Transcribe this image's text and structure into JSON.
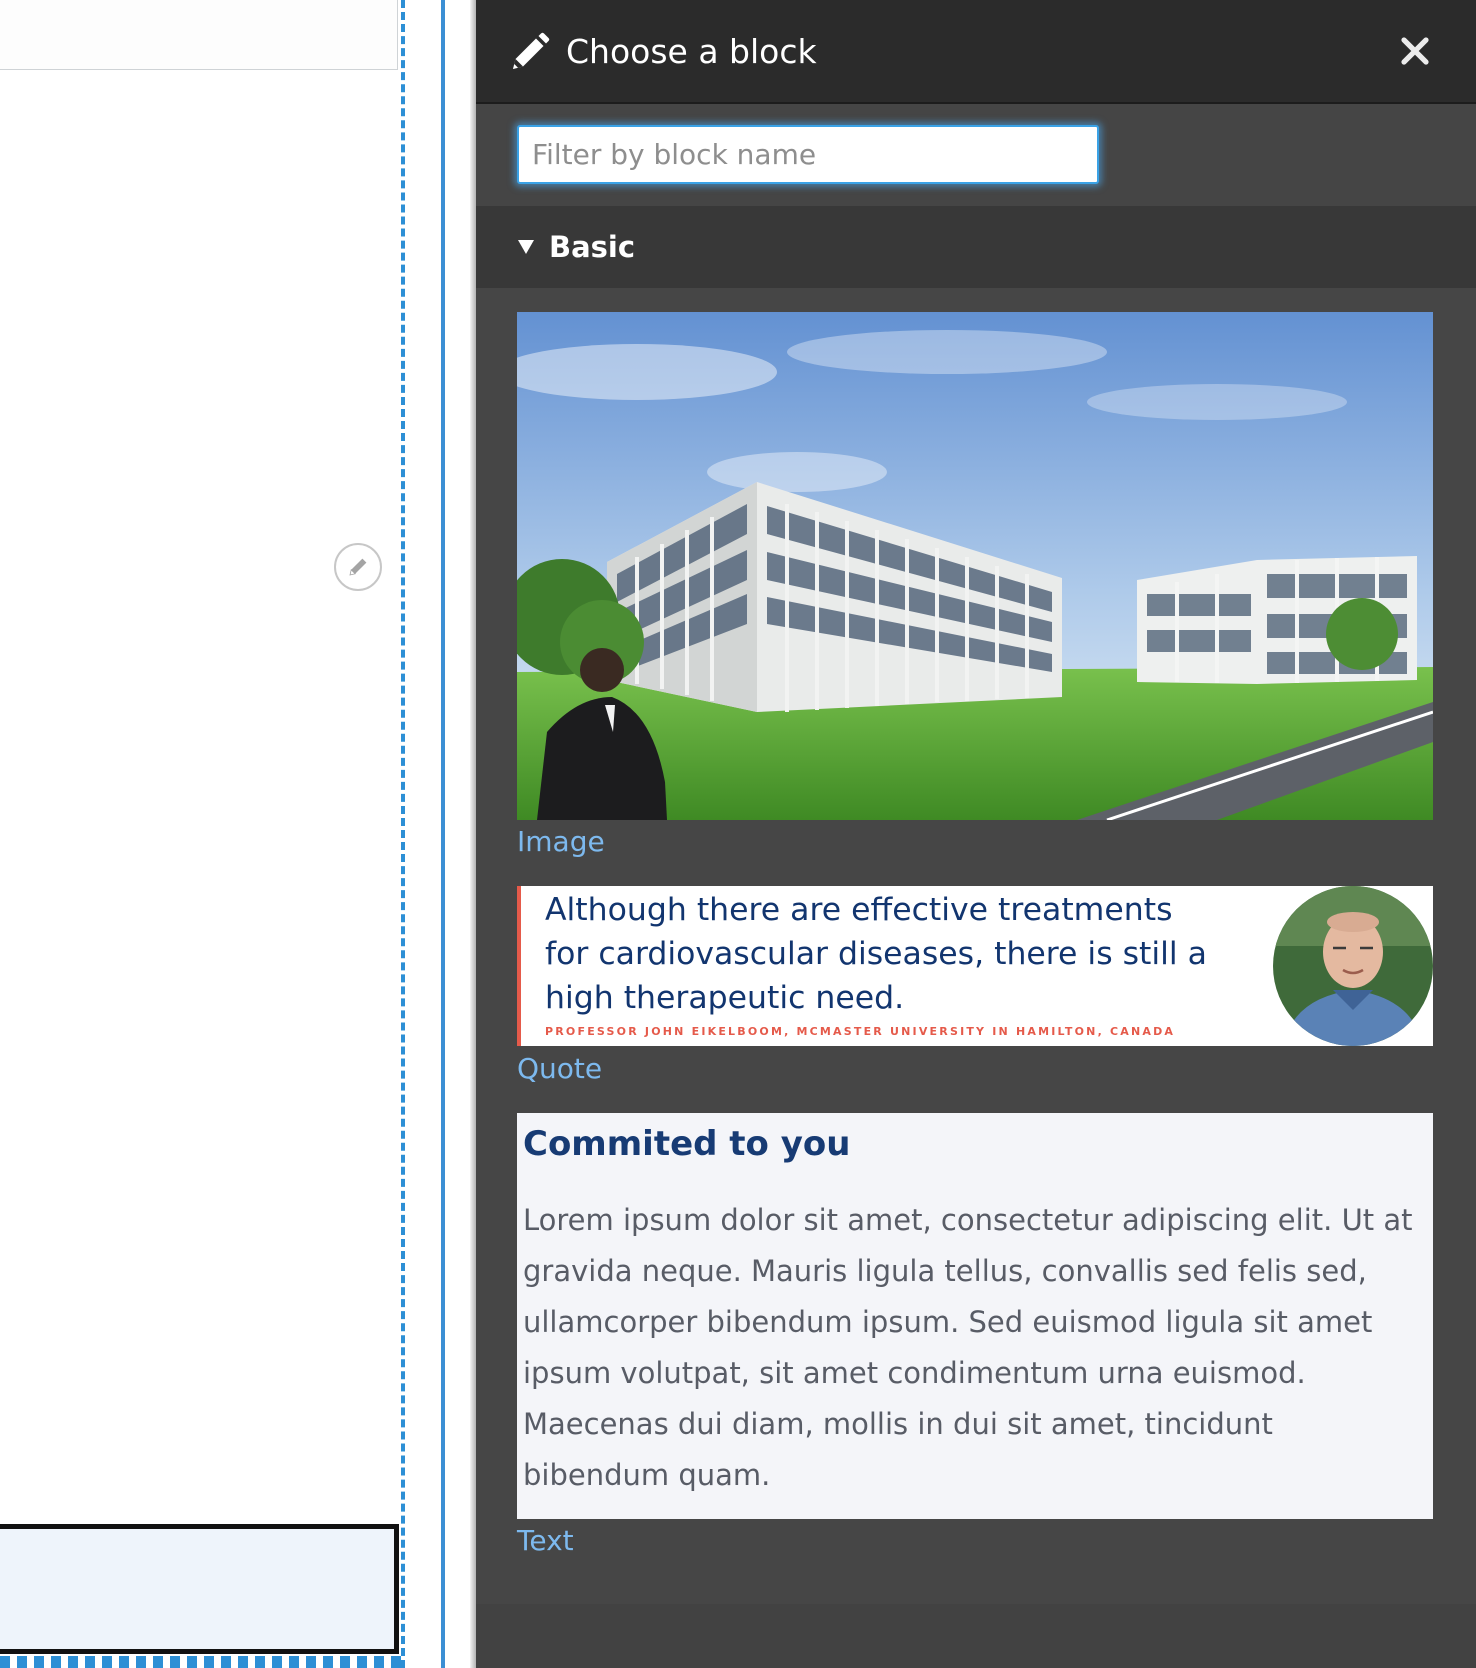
{
  "panel": {
    "title": "Choose a block",
    "title_icon": "pencil-icon",
    "close_icon": "close-icon",
    "filter": {
      "placeholder": "Filter by block name",
      "value": ""
    },
    "categories": [
      {
        "label": "Basic",
        "expanded": true,
        "blocks": [
          {
            "label": "Image",
            "preview": "building-photo"
          },
          {
            "label": "Quote",
            "preview": {
              "quote": "Although there are effective treatments for cardiovascular diseases, there is still a high therapeutic need.",
              "author": "PROFESSOR JOHN EIKELBOOM, MCMASTER UNIVERSITY IN HAMILTON, CANADA"
            }
          },
          {
            "label": "Text",
            "preview": {
              "heading": "Commited to you",
              "body": "Lorem ipsum dolor sit amet, consectetur adipiscing elit. Ut at gravida neque. Mauris ligula tellus, convallis sed felis sed, ullamcorper bibendum ipsum. Sed euismod ligula sit amet ipsum volutpat, sit amet condimentum urna euismod. Maecenas dui diam, mollis in dui sit amet, tincidunt bibendum quam."
            }
          }
        ]
      }
    ]
  },
  "canvas": {
    "edit_icon": "pencil-icon"
  },
  "colors": {
    "panel_bg": "#464646",
    "header_bg": "#2b2b2b",
    "category_bg": "#383838",
    "link": "#7db9ee",
    "accent_blue": "#3b8fd4",
    "quote_blue": "#12356f",
    "quote_red": "#e55a4a"
  }
}
